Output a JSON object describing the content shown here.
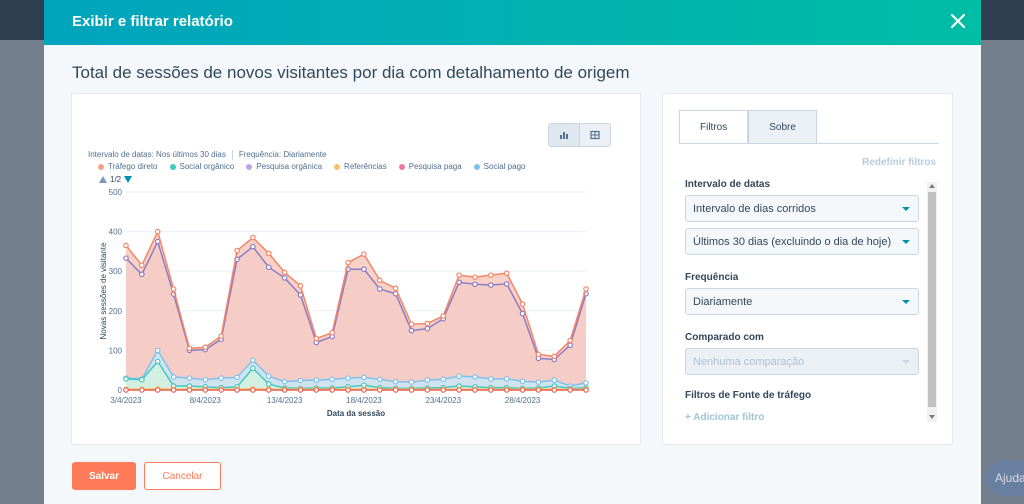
{
  "modal": {
    "title": "Exibir e filtrar relatório",
    "report_title": "Total de sessões de novos visitantes por dia com detalhamento de origem"
  },
  "chart_meta": {
    "date_range": "Intervalo de datas: Nos últimos 30 dias",
    "frequency": "Frequência: Diariamente",
    "pager": "1/2"
  },
  "legend": [
    {
      "label": "Tráfego direto",
      "color": "#f2a188"
    },
    {
      "label": "Social orgânico",
      "color": "#45c7c1"
    },
    {
      "label": "Pesquisa orgânica",
      "color": "#b9a5e8"
    },
    {
      "label": "Referências",
      "color": "#f5c26b"
    },
    {
      "label": "Pesquisa paga",
      "color": "#f2769b"
    },
    {
      "label": "Social pago",
      "color": "#7fc1ea"
    }
  ],
  "chart_data": {
    "type": "area",
    "ylabel": "Novas sessões de visitante",
    "xlabel": "Data da sessão",
    "ylim": [
      0,
      500
    ],
    "yticks": [
      0,
      100,
      200,
      300,
      400,
      500
    ],
    "x": [
      "3/4/2023",
      "4/4/2023",
      "5/4/2023",
      "6/4/2023",
      "7/4/2023",
      "8/4/2023",
      "9/4/2023",
      "10/4/2023",
      "11/4/2023",
      "12/4/2023",
      "13/4/2023",
      "14/4/2023",
      "15/4/2023",
      "16/4/2023",
      "17/4/2023",
      "18/4/2023",
      "19/4/2023",
      "20/4/2023",
      "21/4/2023",
      "22/4/2023",
      "23/4/2023",
      "24/4/2023",
      "25/4/2023",
      "26/4/2023",
      "27/4/2023",
      "28/4/2023",
      "29/4/2023",
      "30/4/2023",
      "1/5/2023",
      "2/5/2023"
    ],
    "xticks": [
      "3/4/2023",
      "8/4/2023",
      "13/4/2023",
      "18/4/2023",
      "23/4/2023",
      "28/4/2023"
    ],
    "grid": true,
    "series": [
      {
        "name": "Pesquisa orgânica",
        "color": "#8e7cc3",
        "fill": "#ddd3f5",
        "values": [
          333,
          292,
          375,
          242,
          100,
          102,
          128,
          330,
          362,
          310,
          283,
          240,
          120,
          135,
          305,
          305,
          255,
          243,
          150,
          155,
          180,
          272,
          267,
          265,
          268,
          193,
          80,
          77,
          113,
          243
        ]
      },
      {
        "name": "Tráfego direto",
        "color": "#f2866b",
        "fill": "#f8c9bd",
        "values": [
          365,
          315,
          400,
          255,
          105,
          108,
          136,
          352,
          385,
          345,
          297,
          263,
          130,
          145,
          322,
          343,
          277,
          257,
          166,
          168,
          187,
          290,
          285,
          290,
          295,
          217,
          90,
          85,
          125,
          255
        ]
      },
      {
        "name": "Social pago",
        "color": "#7fc1ea",
        "fill": "#cbe6f7",
        "values": [
          30,
          28,
          100,
          33,
          30,
          26,
          30,
          32,
          75,
          35,
          21,
          24,
          25,
          27,
          30,
          32,
          27,
          21,
          20,
          25,
          27,
          35,
          33,
          28,
          28,
          22,
          20,
          25,
          10,
          18
        ]
      },
      {
        "name": "Social orgânico",
        "color": "#45c7c1",
        "fill": "#d3f1df",
        "values": [
          28,
          26,
          72,
          10,
          10,
          8,
          6,
          8,
          55,
          15,
          5,
          4,
          5,
          5,
          8,
          12,
          6,
          4,
          4,
          5,
          6,
          10,
          8,
          6,
          6,
          4,
          5,
          10,
          4,
          5
        ]
      },
      {
        "name": "Referências",
        "color": "#f5c26b",
        "fill": null,
        "values": [
          2,
          2,
          3,
          2,
          2,
          2,
          2,
          2,
          3,
          2,
          2,
          2,
          2,
          2,
          2,
          2,
          2,
          2,
          2,
          2,
          2,
          2,
          2,
          2,
          2,
          2,
          2,
          2,
          2,
          2
        ]
      },
      {
        "name": "Pesquisa paga",
        "color": "#e8624f",
        "fill": null,
        "values": [
          0,
          0,
          0,
          0,
          0,
          0,
          0,
          0,
          0,
          0,
          0,
          0,
          0,
          0,
          0,
          0,
          0,
          0,
          0,
          0,
          0,
          0,
          0,
          0,
          0,
          0,
          0,
          0,
          0,
          0
        ]
      }
    ]
  },
  "filters": {
    "tab_filters": "Filtros",
    "tab_about": "Sobre",
    "reset": "Redefinir filtros",
    "date_range_label": "Intervalo de datas",
    "date_range_type": "Intervalo de dias corridos",
    "date_range_value": "Últimos 30 dias (excluindo o dia de hoje)",
    "frequency_label": "Frequência",
    "frequency_value": "Diariamente",
    "compare_label": "Comparado com",
    "compare_value": "Nenhuma comparação",
    "source_filters_label": "Filtros de Fonte de tráfego",
    "add_filter": "+ Adicionar filtro"
  },
  "footer": {
    "save": "Salvar",
    "cancel": "Cancelar"
  },
  "help": "Ajuda"
}
